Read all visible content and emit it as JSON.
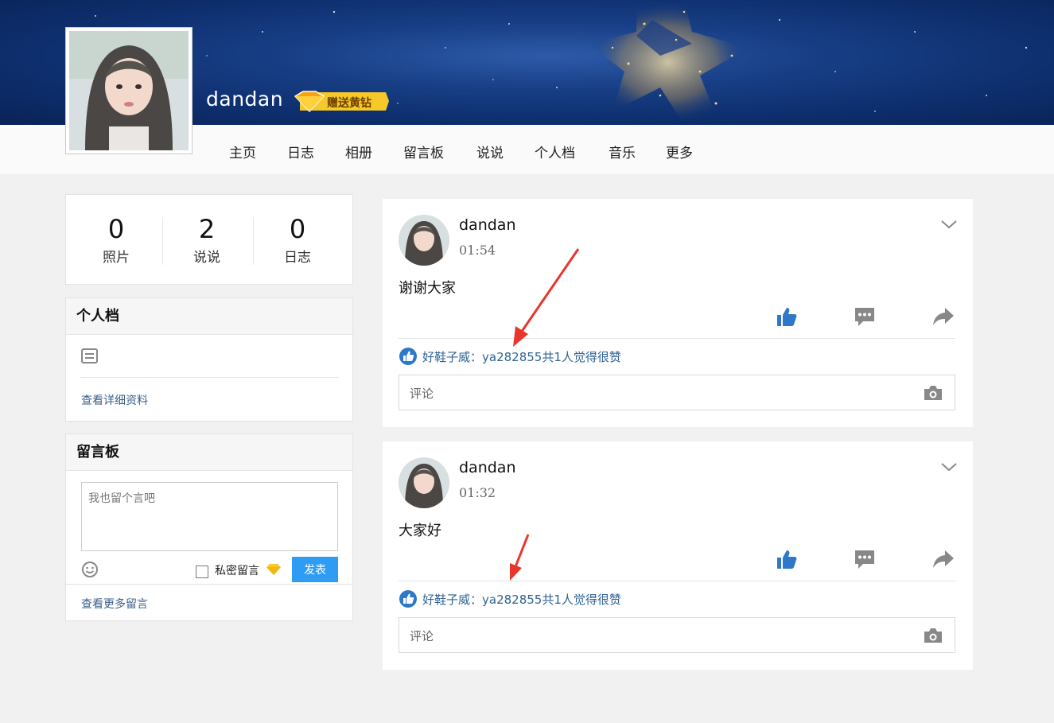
{
  "profile": {
    "username": "dandan",
    "vip_label": "赠送黄钻"
  },
  "nav": {
    "items": [
      "主页",
      "日志",
      "相册",
      "留言板",
      "说说",
      "个人档",
      "音乐",
      "更多"
    ]
  },
  "stats": [
    {
      "value": "0",
      "label": "照片"
    },
    {
      "value": "2",
      "label": "说说"
    },
    {
      "value": "0",
      "label": "日志"
    }
  ],
  "profile_panel": {
    "title": "个人档",
    "detail_link": "查看详细资料"
  },
  "guestbook": {
    "title": "留言板",
    "placeholder": "我也留个言吧",
    "private_label": "私密留言",
    "post_button": "发表",
    "more_link": "查看更多留言"
  },
  "posts": [
    {
      "author": "dandan",
      "time": "01:54",
      "text": "谢谢大家",
      "likes_text": "好鞋子威：ya282855共1人觉得很赞",
      "comment_placeholder": "评论"
    },
    {
      "author": "dandan",
      "time": "01:32",
      "text": "大家好",
      "likes_text": "好鞋子威：ya282855共1人觉得很赞",
      "comment_placeholder": "评论"
    }
  ],
  "colors": {
    "accent_blue": "#2e9cf3",
    "like_blue": "#2f78c9",
    "link_blue": "#2f6396",
    "annotation_red": "#e8362d",
    "vip_gold": "#f7c928"
  }
}
